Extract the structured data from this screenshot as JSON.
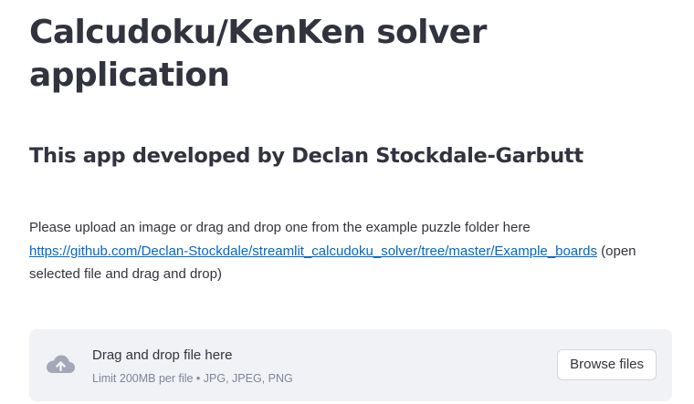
{
  "header": {
    "title": "Calcudoku/KenKen solver application",
    "subtitle": "This app developed by Declan Stockdale-Garbutt"
  },
  "intro": {
    "text_before_link": "Please upload an image or drag and drop one from the example puzzle folder here",
    "link_text": "https://github.com/Declan-Stockdale/streamlit_calcudoku_solver/tree/master/Example_boards",
    "text_after_link": " (open selected file and drag and drop)"
  },
  "uploader": {
    "icon": "cloud-upload-icon",
    "drop_label": "Drag and drop file here",
    "limit_label": "Limit 200MB per file • JPG, JPEG, PNG",
    "browse_label": "Browse files"
  },
  "colors": {
    "text": "#31333f",
    "link": "#0068c9",
    "uploader_bg": "#f0f2f6",
    "muted": "#808495"
  }
}
